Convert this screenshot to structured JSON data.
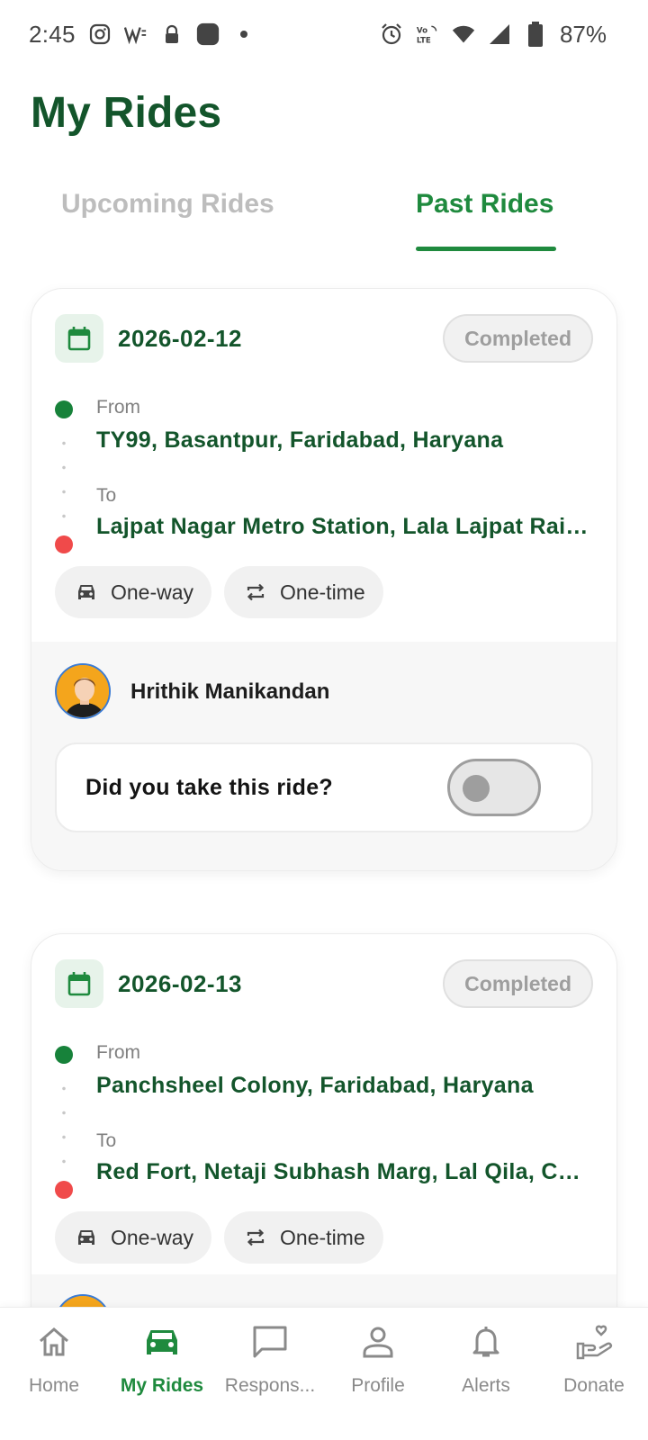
{
  "status_bar": {
    "time": "2:45",
    "battery": "87%"
  },
  "page": {
    "title": "My Rides"
  },
  "tabs": [
    {
      "label": "Upcoming Rides",
      "active": false
    },
    {
      "label": "Past Rides",
      "active": true
    }
  ],
  "rides": [
    {
      "date": "2026-02-12",
      "status": "Completed",
      "from_label": "From",
      "from": "TY99, Basantpur, Faridabad, Haryana",
      "to_label": "To",
      "to": "Lajpat Nagar Metro Station, Lala Lajpat Rai Road",
      "trip_type": "One-way",
      "frequency": "One-time",
      "driver": "Hrithik Manikandan",
      "confirm_question": "Did you take this ride?",
      "confirmed": false
    },
    {
      "date": "2026-02-13",
      "status": "Completed",
      "from_label": "From",
      "from": "Panchsheel Colony, Faridabad, Haryana",
      "to_label": "To",
      "to": "Red Fort, Netaji Subhash Marg, Lal Qila, Chandni Chowk",
      "trip_type": "One-way",
      "frequency": "One-time"
    }
  ],
  "bottom_nav": [
    {
      "label": "Home",
      "icon": "home-icon",
      "active": false
    },
    {
      "label": "My Rides",
      "icon": "car-icon",
      "active": true
    },
    {
      "label": "Respons...",
      "icon": "chat-icon",
      "active": false
    },
    {
      "label": "Profile",
      "icon": "person-icon",
      "active": false
    },
    {
      "label": "Alerts",
      "icon": "bell-icon",
      "active": false
    },
    {
      "label": "Donate",
      "icon": "donate-icon",
      "active": false
    }
  ],
  "colors": {
    "primary": "#1f8a3e",
    "title": "#13552b",
    "to_dot": "#f04a4a"
  }
}
